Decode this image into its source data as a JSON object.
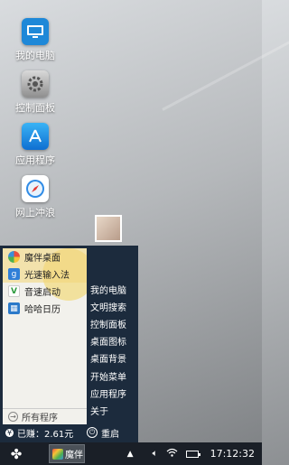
{
  "desktop": {
    "icons": [
      {
        "label": "我的电脑",
        "icon": "computer-icon"
      },
      {
        "label": "控制面板",
        "icon": "settings-gear-icon"
      },
      {
        "label": "应用程序",
        "icon": "app-store-icon"
      },
      {
        "label": "网上冲浪",
        "icon": "safari-compass-icon"
      }
    ]
  },
  "start_menu": {
    "left_items": [
      {
        "label": "魔伴桌面",
        "icon": "pinwheel-icon"
      },
      {
        "label": "光速输入法",
        "icon": "input-method-icon"
      },
      {
        "label": "音速启动",
        "icon": "v-launcher-icon"
      },
      {
        "label": "哈哈日历",
        "icon": "calendar-icon"
      }
    ],
    "all_programs": "所有程序",
    "right_items": [
      "我的电脑",
      "文明搜索",
      "控制面板",
      "桌面图标",
      "桌面背景",
      "开始菜单",
      "应用程序",
      "关于"
    ],
    "earned_label": "已赚：2.61元",
    "restart_label": "重启"
  },
  "taskbar": {
    "active_app": "魔伴",
    "time": "17:12:32"
  },
  "colors": {
    "menu_bg": "#1c2b3d",
    "taskbar_bg": "#1a1f27",
    "highlight": "#f2d678"
  }
}
